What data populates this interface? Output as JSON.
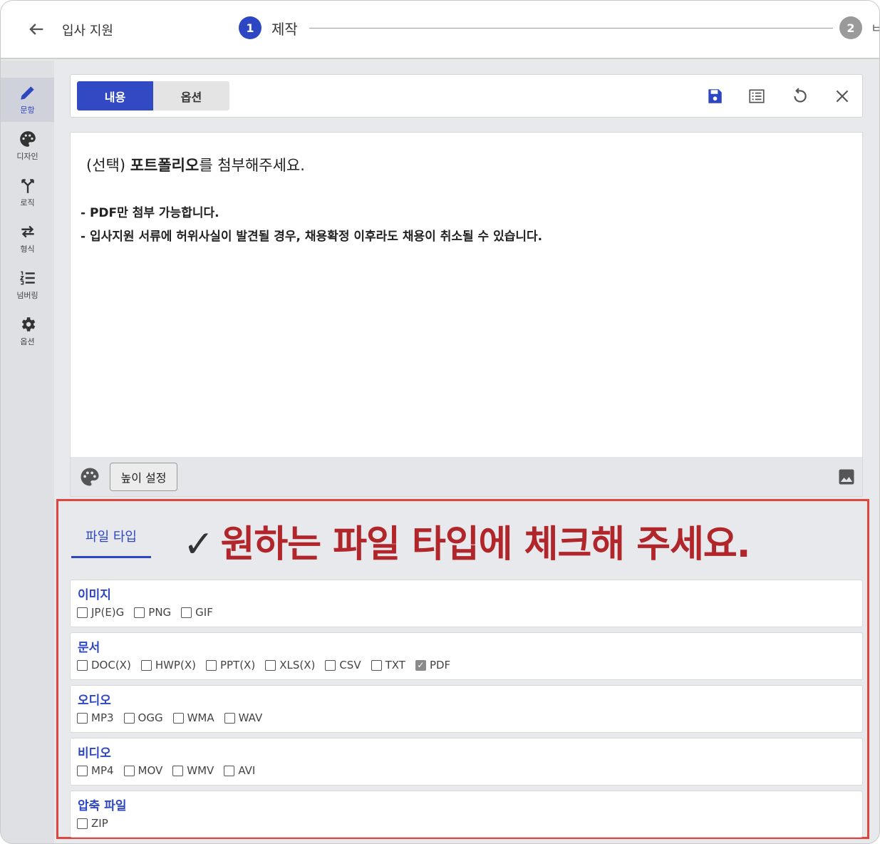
{
  "header": {
    "title": "입사 지원",
    "steps": [
      {
        "number": "1",
        "label": "제작"
      },
      {
        "number": "2",
        "label": "ㅂ"
      }
    ]
  },
  "rail": {
    "items": [
      {
        "label": "문항",
        "icon": "pencil-icon"
      },
      {
        "label": "디자인",
        "icon": "palette-icon"
      },
      {
        "label": "로직",
        "icon": "branch-icon"
      },
      {
        "label": "형식",
        "icon": "swap-icon"
      },
      {
        "label": "넘버링",
        "icon": "numbered-list-icon"
      },
      {
        "label": "옵션",
        "icon": "gear-icon"
      }
    ]
  },
  "toolbar": {
    "tab_content": "내용",
    "tab_options": "옵션",
    "icons": [
      "save-icon",
      "list-icon",
      "refresh-icon",
      "close-icon"
    ]
  },
  "editor": {
    "line1_prefix": "(선택) ",
    "line1_bold": "포트폴리오",
    "line1_suffix": "를 첨부해주세요.",
    "line2": "- PDF만 첨부 가능합니다.",
    "line3": "- 입사지원 서류에 허위사실이 발견될 경우, 채용확정 이후라도 채용이 취소될 수 있습니다.",
    "height_button": "높이 설정"
  },
  "file_types": {
    "tab_label": "파일 타입",
    "check_mark": "✓",
    "instruction": "원하는 파일 타입에 체크해 주세요.",
    "groups": [
      {
        "title": "이미지",
        "options": [
          {
            "label": "JP(E)G",
            "checked": false
          },
          {
            "label": "PNG",
            "checked": false
          },
          {
            "label": "GIF",
            "checked": false
          }
        ]
      },
      {
        "title": "문서",
        "options": [
          {
            "label": "DOC(X)",
            "checked": false
          },
          {
            "label": "HWP(X)",
            "checked": false
          },
          {
            "label": "PPT(X)",
            "checked": false
          },
          {
            "label": "XLS(X)",
            "checked": false
          },
          {
            "label": "CSV",
            "checked": false
          },
          {
            "label": "TXT",
            "checked": false
          },
          {
            "label": "PDF",
            "checked": true
          }
        ]
      },
      {
        "title": "오디오",
        "options": [
          {
            "label": "MP3",
            "checked": false
          },
          {
            "label": "OGG",
            "checked": false
          },
          {
            "label": "WMA",
            "checked": false
          },
          {
            "label": "WAV",
            "checked": false
          }
        ]
      },
      {
        "title": "비디오",
        "options": [
          {
            "label": "MP4",
            "checked": false
          },
          {
            "label": "MOV",
            "checked": false
          },
          {
            "label": "WMV",
            "checked": false
          },
          {
            "label": "AVI",
            "checked": false
          }
        ]
      },
      {
        "title": "압축 파일",
        "options": [
          {
            "label": "ZIP",
            "checked": false
          }
        ]
      }
    ]
  },
  "colors": {
    "accent": "#2d47c2",
    "highlight_border": "#e0463d",
    "instruction_text": "#b1262a"
  }
}
